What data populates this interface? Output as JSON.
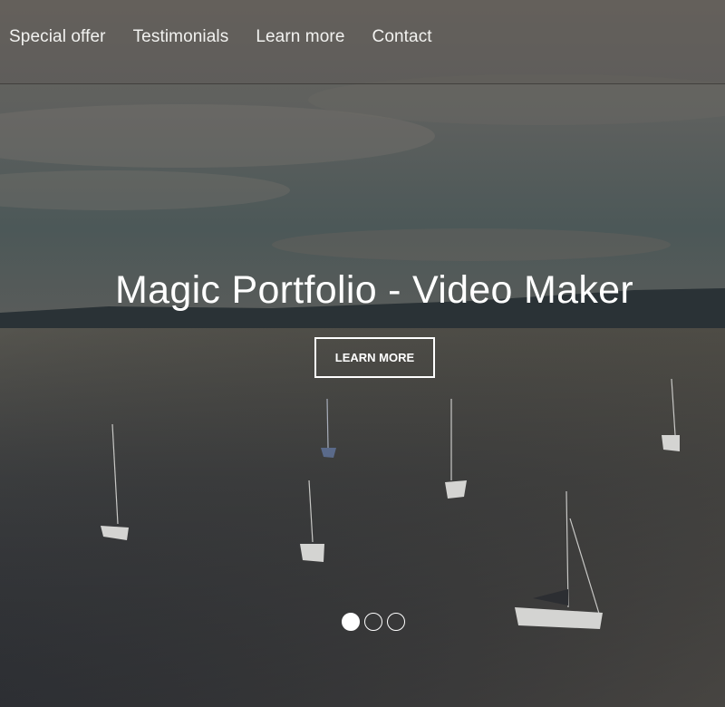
{
  "nav": {
    "items": [
      {
        "label": "Special offer"
      },
      {
        "label": "Testimonials"
      },
      {
        "label": "Learn more"
      },
      {
        "label": "Contact"
      }
    ]
  },
  "hero": {
    "title": "Magic Portfolio - Video Maker",
    "button_label": "LEARN MORE",
    "background": "lake-with-sailboats-at-dusk"
  },
  "carousel": {
    "slide_count": 3,
    "active_index": 0
  },
  "colors": {
    "text": "#ffffff",
    "nav_overlay": "#5c5854",
    "sky": "#5a5e60",
    "water": "#3e4044"
  }
}
